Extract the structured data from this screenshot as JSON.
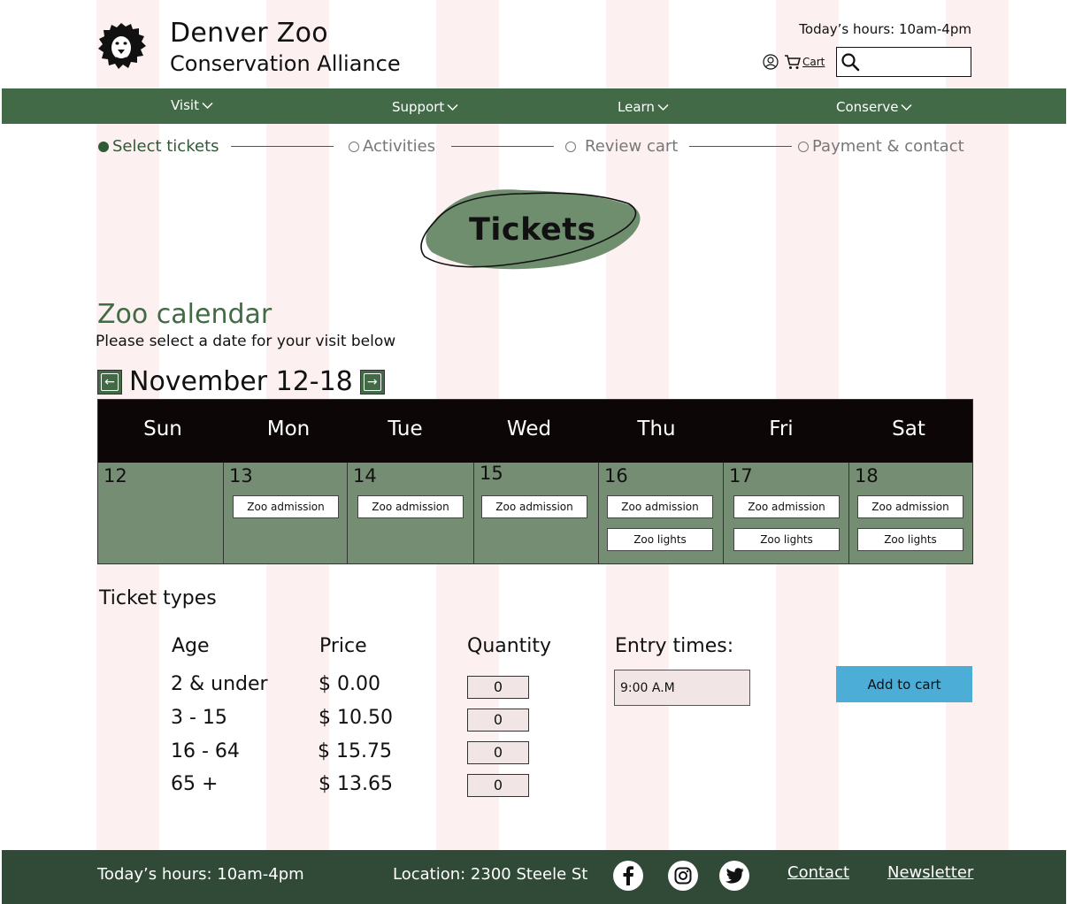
{
  "header": {
    "brand_line1": "Denver Zoo",
    "brand_line2": "Conservation Alliance",
    "hours": "Today’s hours: 10am-4pm",
    "cart_label": "Cart",
    "search_placeholder": "",
    "account_icon": "user-icon",
    "cart_icon": "cart-icon",
    "search_icon": "search-icon",
    "logo_icon": "lion-logo"
  },
  "nav": {
    "items": [
      {
        "label": "Visit"
      },
      {
        "label": "Support"
      },
      {
        "label": "Learn"
      },
      {
        "label": "Conserve"
      }
    ]
  },
  "stepper": {
    "steps": [
      {
        "label": "Select tickets",
        "active": true
      },
      {
        "label": "Activities",
        "active": false
      },
      {
        "label": "Review cart",
        "active": false
      },
      {
        "label": "Payment & contact",
        "active": false
      }
    ]
  },
  "page_badge": "Tickets",
  "calendar": {
    "title": "Zoo calendar",
    "subtitle": "Please select a date for your visit below",
    "week_label": "November 12-18",
    "days": [
      {
        "name": "Sun",
        "date": "12",
        "events": []
      },
      {
        "name": "Mon",
        "date": "13",
        "events": [
          "Zoo admission"
        ]
      },
      {
        "name": "Tue",
        "date": "14",
        "events": [
          "Zoo admission"
        ]
      },
      {
        "name": "Wed",
        "date": "15",
        "events": [
          "Zoo admission"
        ]
      },
      {
        "name": "Thu",
        "date": "16",
        "events": [
          "Zoo admission",
          "Zoo lights"
        ]
      },
      {
        "name": "Fri",
        "date": "17",
        "events": [
          "Zoo admission",
          "Zoo lights"
        ]
      },
      {
        "name": "Sat",
        "date": "18",
        "events": [
          "Zoo admission",
          "Zoo lights"
        ]
      }
    ]
  },
  "tickets": {
    "title": "Ticket types",
    "col_age": "Age",
    "col_price": "Price",
    "col_quantity": "Quantity",
    "col_entry": "Entry times:",
    "rows": [
      {
        "age": "2 & under",
        "price": "$ 0.00",
        "quantity": "0"
      },
      {
        "age": "3 - 15",
        "price": "$ 10.50",
        "quantity": "0"
      },
      {
        "age": "16 - 64",
        "price": "$ 15.75",
        "quantity": "0"
      },
      {
        "age": "65 +",
        "price": "$ 13.65",
        "quantity": "0"
      }
    ],
    "entry_time": "9:00 A.M",
    "add_to_cart": "Add to cart"
  },
  "footer": {
    "hours": "Today’s hours: 10am-4pm",
    "location": "Location: 2300 Steele St",
    "contact": "Contact",
    "newsletter": "Newsletter",
    "social_icons": [
      "facebook-icon",
      "instagram-icon",
      "twitter-icon"
    ]
  },
  "colors": {
    "brand_green": "#426a46",
    "calendar_body": "#758d72",
    "footer_green": "#304a37",
    "add_button": "#4cadd6",
    "column_tint": "#fcf1f0"
  }
}
